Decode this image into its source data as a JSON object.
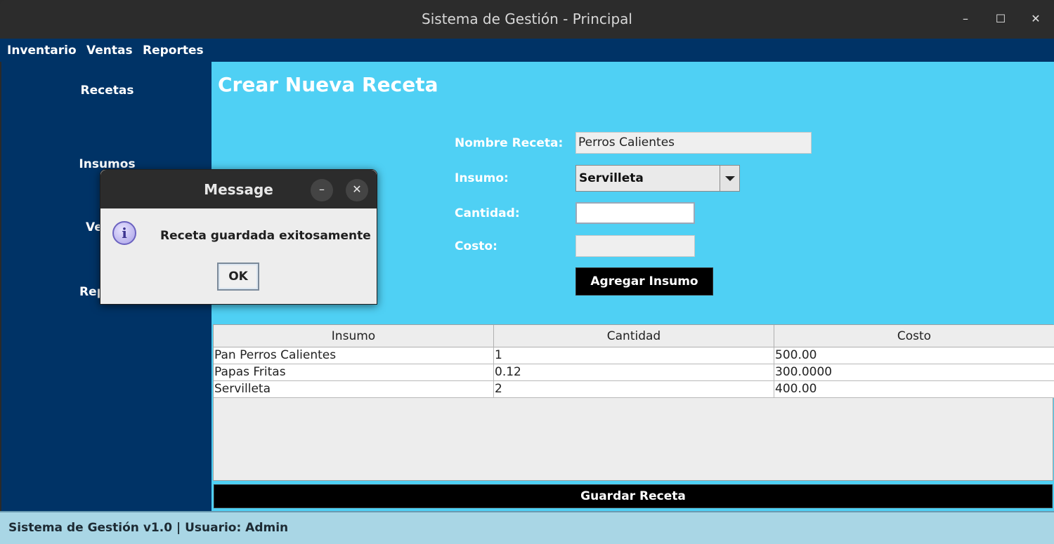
{
  "window": {
    "title": "Sistema de Gestión - Principal",
    "min_glyph": "–",
    "max_glyph": "☐",
    "close_glyph": "✕"
  },
  "menubar": {
    "items": [
      "Inventario",
      "Ventas",
      "Reportes"
    ]
  },
  "sidebar": {
    "items": [
      "Recetas",
      "Insumos",
      "Ve",
      "Rep"
    ]
  },
  "main": {
    "title": "Crear Nueva Receta",
    "form": {
      "nombre_label": "Nombre Receta:",
      "nombre_value": "Perros Calientes",
      "insumo_label": "Insumo:",
      "insumo_selected": "Servilleta",
      "cantidad_label": "Cantidad:",
      "cantidad_value": "",
      "costo_label": "Costo:",
      "costo_value": "",
      "add_button": "Agregar Insumo"
    },
    "table": {
      "headers": [
        "Insumo",
        "Cantidad",
        "Costo"
      ],
      "rows": [
        [
          "Pan Perros Calientes",
          "1",
          "500.00"
        ],
        [
          "Papas Fritas",
          "0.12",
          "300.0000"
        ],
        [
          "Servilleta",
          "2",
          "400.00"
        ]
      ]
    },
    "save_button": "Guardar Receta"
  },
  "statusbar": {
    "text": "Sistema de Gestión v1.0 | Usuario: Admin"
  },
  "dialog": {
    "title": "Message",
    "message": "Receta guardada exitosamente",
    "ok_label": "OK",
    "icon": "info-icon",
    "icon_glyph": "i",
    "min_glyph": "–",
    "close_glyph": "✕"
  },
  "colors": {
    "nav_bg": "#003366",
    "content_bg": "#4fd0f4",
    "status_bg": "#a9d6e5",
    "button_bg": "#000000"
  }
}
